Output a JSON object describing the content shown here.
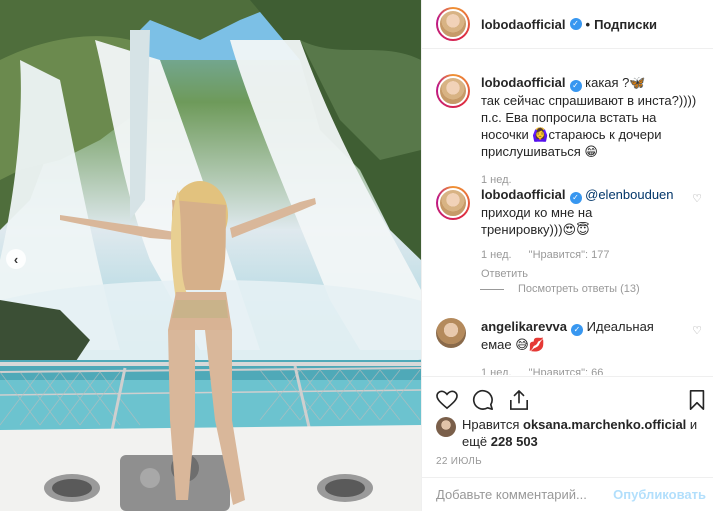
{
  "post": {
    "username": "lobodaofficial",
    "follow_label": "Подписки",
    "dot": "•"
  },
  "caption": {
    "username": "lobodaofficial",
    "line1": "какая ?🦋",
    "line2": "так сейчас спрашивают в инста?))))",
    "line3": "п.с. Ева попросила встать на",
    "line4": "носочки 🙆‍♀️стараюсь к дочери",
    "line5": "прислушиваться 😁",
    "time": "1 нед."
  },
  "comments": [
    {
      "username": "lobodaofficial",
      "mention": "@elenbouduen",
      "text1": "приходи ко мне на",
      "text2": "тренировку)))😍😇",
      "time": "1 нед.",
      "likes": "\"Нравится\": 177",
      "reply": "Ответить",
      "view_replies": "Посмотреть ответы (13)"
    },
    {
      "username": "angelikarevva",
      "text1": "Идеальная",
      "text2": "емае 😅💋",
      "time": "1 нед.",
      "likes": "\"Нравится\": 66"
    }
  ],
  "likes": {
    "prefix": "Нравится",
    "user": "oksana.marchenko.official",
    "joiner": "и",
    "more_prefix": "ещё",
    "count": "228 503"
  },
  "date": "22 ИЮЛЬ",
  "add_comment": {
    "placeholder": "Добавьте комментарий...",
    "publish_label": "Опубликовать"
  },
  "icons": {
    "heart": "heart-icon",
    "comment": "comment-icon",
    "share": "share-icon",
    "bookmark": "bookmark-icon",
    "verified": "verified-badge-icon",
    "prev": "chevron-left-icon"
  },
  "colors": {
    "verified": "#3897f0",
    "mention": "#003569",
    "muted": "#999999",
    "publish": "#b2dffc"
  }
}
